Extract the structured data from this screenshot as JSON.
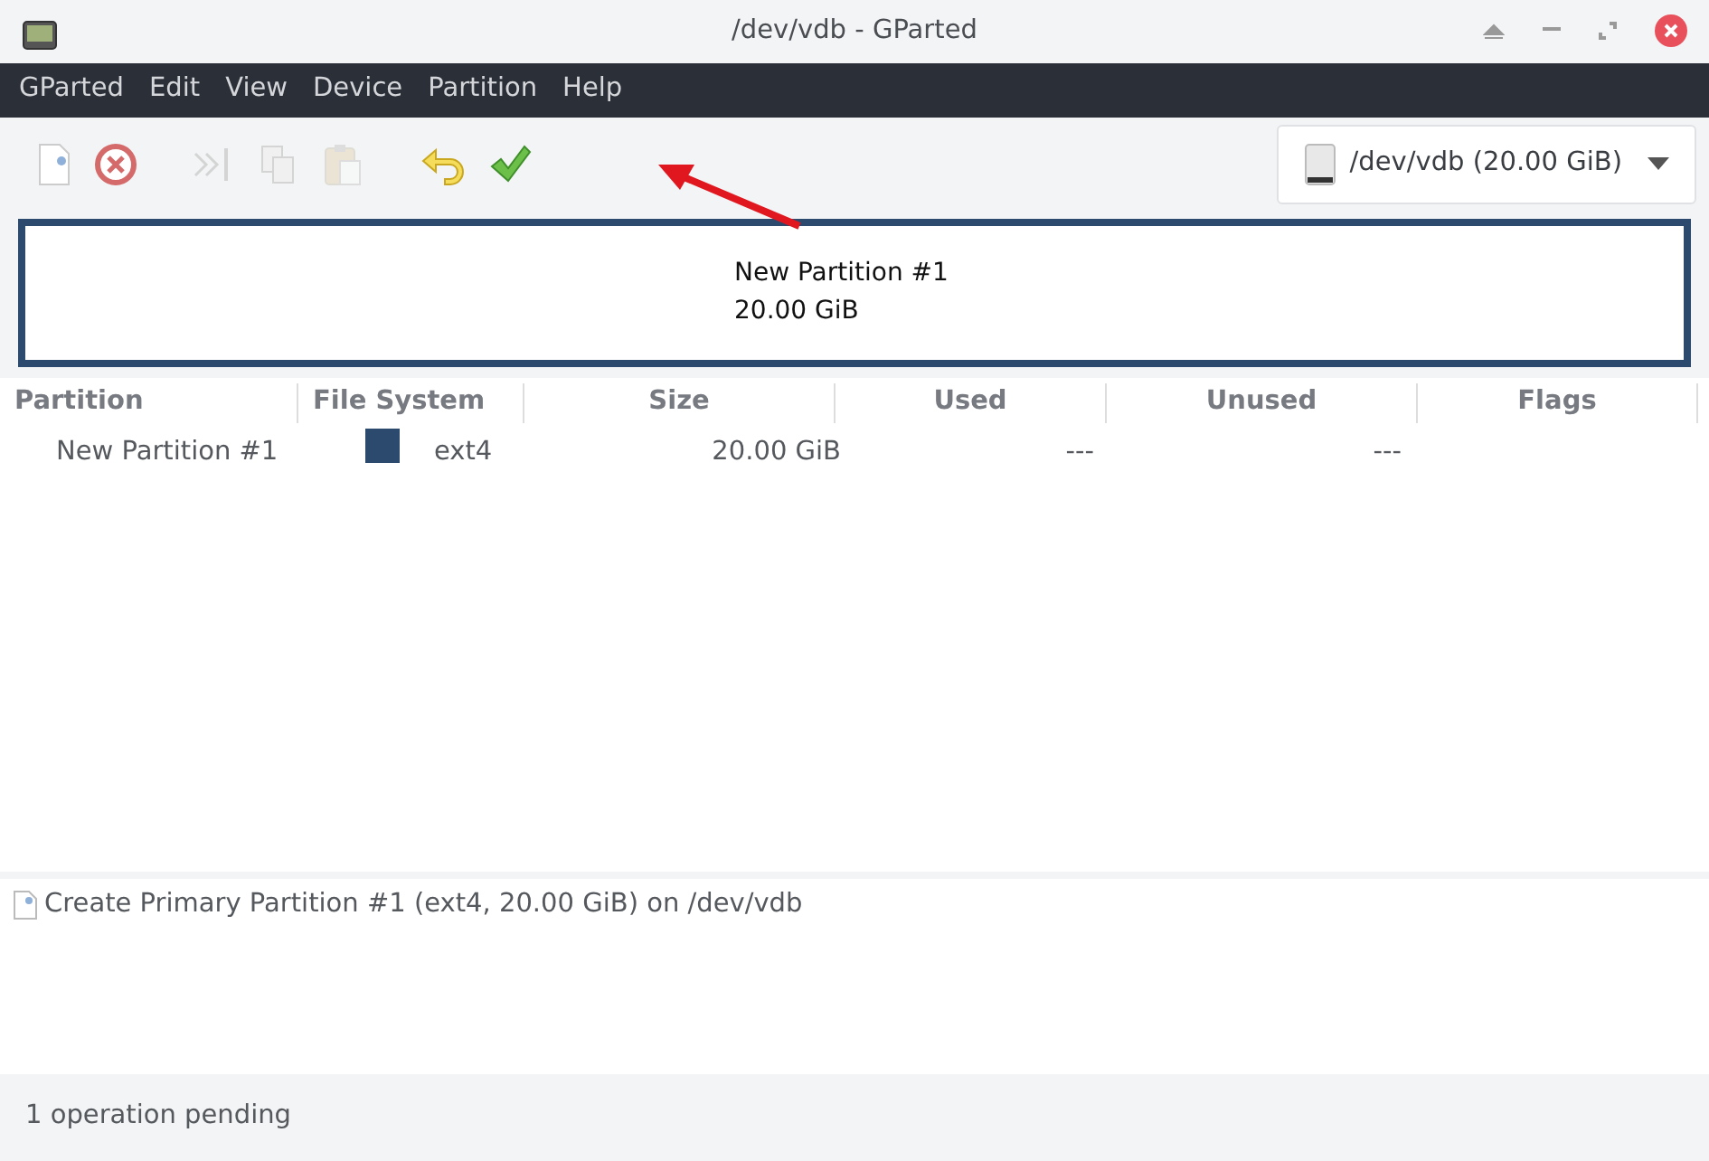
{
  "window": {
    "title": "/dev/vdb - GParted"
  },
  "menu": [
    "GParted",
    "Edit",
    "View",
    "Device",
    "Partition",
    "Help"
  ],
  "toolbar": [
    {
      "kind": "new",
      "disabled": false
    },
    {
      "kind": "delete",
      "disabled": false
    },
    {
      "kind": "resize",
      "disabled": true
    },
    {
      "kind": "copy",
      "disabled": true
    },
    {
      "kind": "paste",
      "disabled": true
    },
    {
      "kind": "undo",
      "disabled": false
    },
    {
      "kind": "apply",
      "disabled": false
    }
  ],
  "device": {
    "label": "/dev/vdb (20.00 GiB)"
  },
  "disk_map": {
    "name": "New Partition #1",
    "size": "20.00 GiB"
  },
  "table": {
    "columns": [
      "Partition",
      "File System",
      "Size",
      "Used",
      "Unused",
      "Flags"
    ],
    "rows": [
      {
        "partition": "New Partition #1",
        "color": "#2c4a6e",
        "file_system": "ext4",
        "size": "20.00 GiB",
        "used": "---",
        "unused": "---",
        "flags": ""
      }
    ]
  },
  "operations": [
    "Create Primary Partition #1 (ext4, 20.00 GiB) on /dev/vdb"
  ],
  "status_bar": "1 operation pending"
}
